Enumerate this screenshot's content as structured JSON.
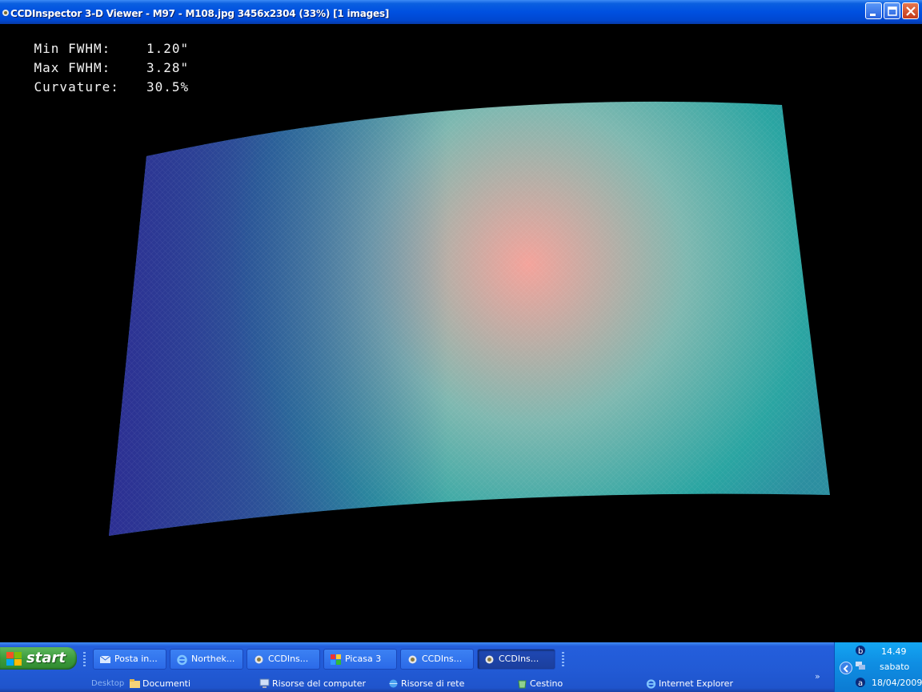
{
  "window": {
    "title": "CCDInspector 3-D Viewer - M97 - M108.jpg 3456x2304 (33%) [1 images]"
  },
  "stats": [
    {
      "label": "Min FWHM:",
      "value": "1.20\""
    },
    {
      "label": "Max FWHM:",
      "value": "3.28\""
    },
    {
      "label": "Curvature:",
      "value": "30.5%"
    }
  ],
  "surface": {
    "colors": {
      "low": "#2c2a92",
      "mid": "#2aa5a2",
      "high": "#f4a39b",
      "mesh": "#ffffff"
    }
  },
  "taskbar": {
    "start_label": "start",
    "tasks": [
      {
        "label": "Posta in...",
        "icon": "mail-icon"
      },
      {
        "label": "Northek...",
        "icon": "ie-icon"
      },
      {
        "label": "CCDIns...",
        "icon": "ccdinspector-icon"
      },
      {
        "label": "Picasa 3",
        "icon": "picasa-icon"
      },
      {
        "label": "CCDIns...",
        "icon": "ccdinspector-icon"
      },
      {
        "label": "CCDIns...",
        "icon": "ccdinspector-icon"
      }
    ],
    "quicklinks": {
      "desktop": "Desktop",
      "items": [
        {
          "label": "Documenti",
          "icon": "folder-icon"
        },
        {
          "label": "Risorse del computer",
          "icon": "computer-icon"
        },
        {
          "label": "Risorse di rete",
          "icon": "network-icon"
        },
        {
          "label": "Cestino",
          "icon": "recycle-bin-icon"
        },
        {
          "label": "Internet Explorer",
          "icon": "ie-icon"
        }
      ],
      "more": "»"
    },
    "tray": {
      "time": "14.49",
      "day": "sabato",
      "date": "18/04/2009"
    }
  }
}
